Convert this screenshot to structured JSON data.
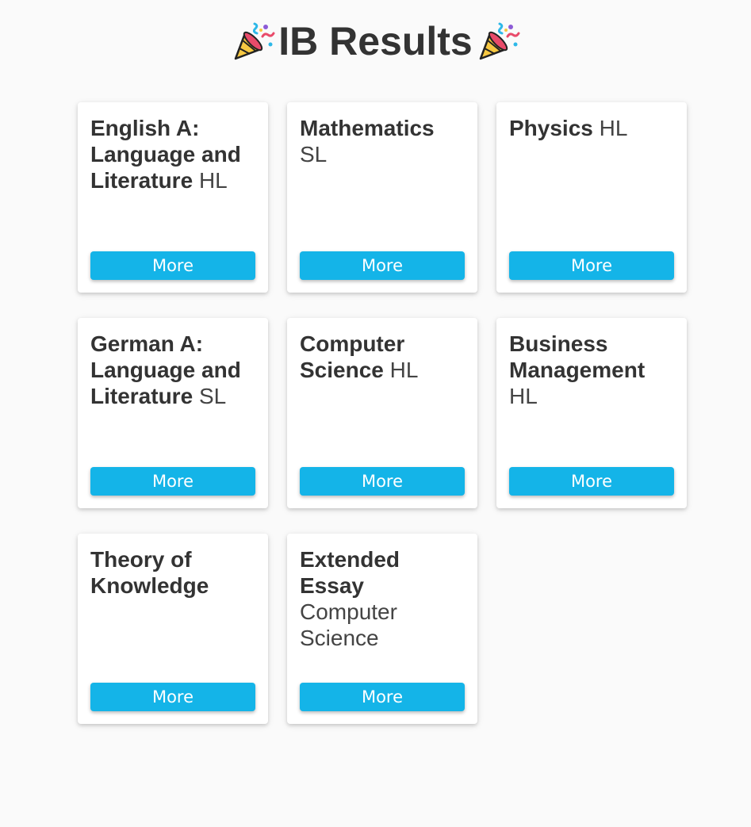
{
  "header": {
    "title": "IB Results",
    "left_icon": "party-popper-icon",
    "right_icon": "party-popper-icon"
  },
  "colors": {
    "button": "#14b4e8",
    "card_background": "#ffffff",
    "page_background": "#fafafa",
    "text": "#333333"
  },
  "subjects": [
    {
      "name": "English A: Language and Literature",
      "level": "HL",
      "button_label": "More"
    },
    {
      "name": "Mathematics",
      "level": "SL",
      "button_label": "More"
    },
    {
      "name": "Physics",
      "level": "HL",
      "button_label": "More"
    },
    {
      "name": "German A: Language and Literature",
      "level": "SL",
      "button_label": "More"
    },
    {
      "name": "Computer Science",
      "level": "HL",
      "button_label": "More"
    },
    {
      "name": "Business Management",
      "level": "HL",
      "button_label": "More"
    },
    {
      "name": "Theory of Knowledge",
      "level": "",
      "button_label": "More"
    },
    {
      "name": "Extended Essay",
      "level": "Computer Science",
      "button_label": "More"
    }
  ]
}
